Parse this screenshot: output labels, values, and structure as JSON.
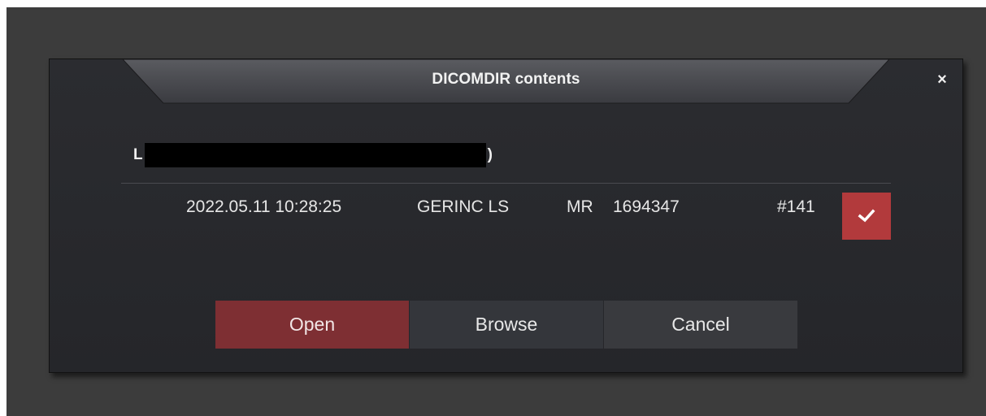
{
  "dialog": {
    "title": "DICOMDIR contents",
    "close_glyph": "×",
    "close_icon": "close-icon"
  },
  "patient": {
    "name_start": "L",
    "name_end": ")"
  },
  "series": [
    {
      "datetime": "2022.05.11 10:28:25",
      "description": "GERINC LS",
      "modality": "MR",
      "id": "1694347",
      "number": "#141",
      "checked": true,
      "check_icon": "checkmark-icon"
    }
  ],
  "buttons": {
    "open": "Open",
    "browse": "Browse",
    "cancel": "Cancel"
  },
  "colors": {
    "accent": "#b23a3c",
    "open_button": "#7e2f33",
    "background": "#3c3c3c",
    "dialog": "#2b2c30"
  }
}
